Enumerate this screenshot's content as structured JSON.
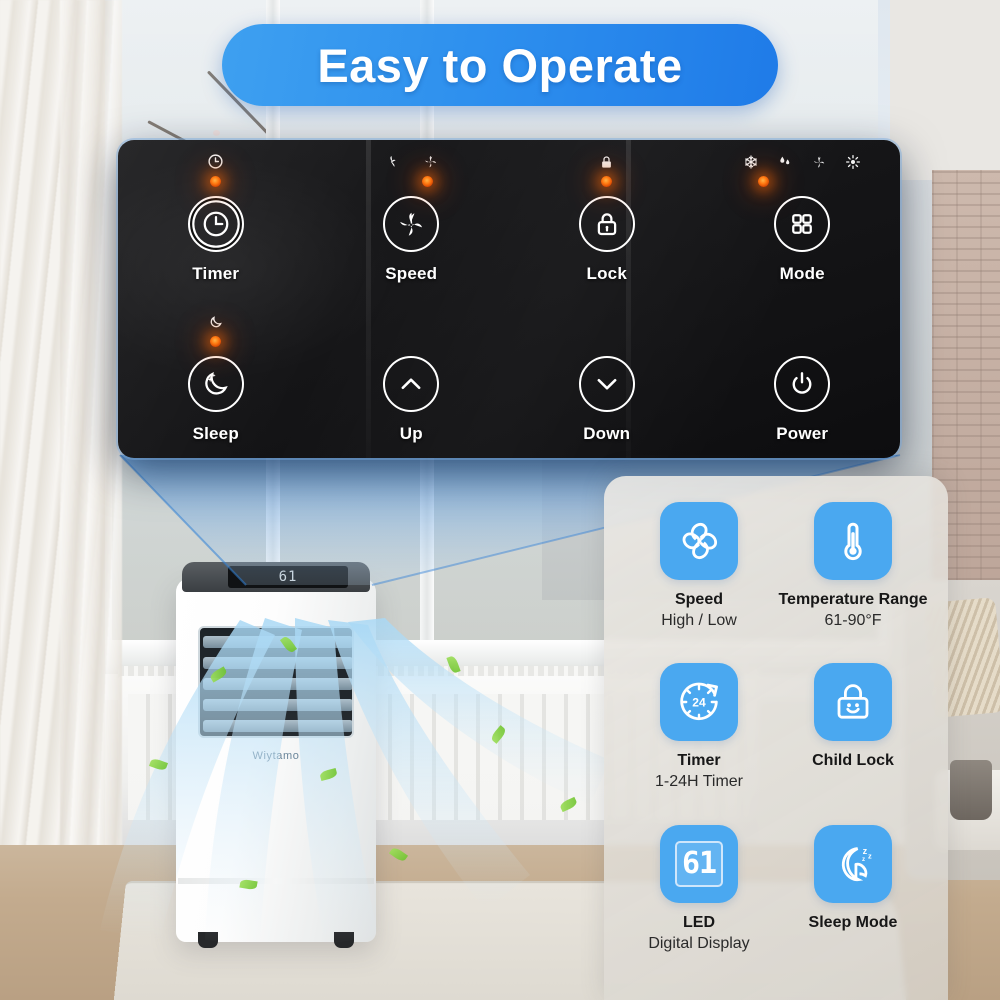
{
  "header": {
    "title": "Easy to Operate",
    "pill_color": "#2e90ee"
  },
  "control_panel": {
    "panel_color": "#151517",
    "led_color": "#ff7a12",
    "buttons": [
      {
        "label": "Timer",
        "icon": "clock-icon",
        "indicators": [
          {
            "icon": "clock-indicator-icon",
            "lit": true
          }
        ]
      },
      {
        "label": "Speed",
        "icon": "fan-icon",
        "indicators": [
          {
            "icon": "fan-low-indicator-icon",
            "lit": false
          },
          {
            "icon": "fan-high-indicator-icon",
            "lit": true
          }
        ]
      },
      {
        "label": "Lock",
        "icon": "lock-icon",
        "indicators": [
          {
            "icon": "lock-indicator-icon",
            "lit": true
          }
        ]
      },
      {
        "label": "Mode",
        "icon": "mode-grid-icon",
        "indicators": [
          {
            "icon": "snowflake-indicator-icon",
            "lit": true
          },
          {
            "icon": "water-drop-indicator-icon",
            "lit": false
          },
          {
            "icon": "fan-indicator-icon",
            "lit": false
          },
          {
            "icon": "sun-indicator-icon",
            "lit": false
          }
        ]
      },
      {
        "label": "Sleep",
        "icon": "moon-icon",
        "indicators": [
          {
            "icon": "moon-indicator-icon",
            "lit": true
          }
        ]
      },
      {
        "label": "Up",
        "icon": "chevron-up-icon",
        "indicators": []
      },
      {
        "label": "Down",
        "icon": "chevron-down-icon",
        "indicators": []
      },
      {
        "label": "Power",
        "icon": "power-icon",
        "indicators": []
      }
    ]
  },
  "features": {
    "tile_color": "#4aa8f0",
    "cards": [
      {
        "icon": "fan-blade-icon",
        "title": "Speed",
        "subtitle": "High / Low"
      },
      {
        "icon": "thermometer-icon",
        "title": "Temperature Range",
        "subtitle": "61-90°F"
      },
      {
        "icon": "timer-24h-icon",
        "title": "Timer",
        "subtitle": "1-24H Timer"
      },
      {
        "icon": "child-lock-icon",
        "title": "Child Lock",
        "subtitle": ""
      },
      {
        "icon": "led-display-icon",
        "title": "LED",
        "subtitle": "Digital Display"
      },
      {
        "icon": "sleep-moon-icon",
        "title": "Sleep Mode",
        "subtitle": ""
      }
    ],
    "timer_tile_text": "24",
    "led_tile_text": "61"
  },
  "product": {
    "brand": "Wiytamo",
    "display_value": "61"
  }
}
